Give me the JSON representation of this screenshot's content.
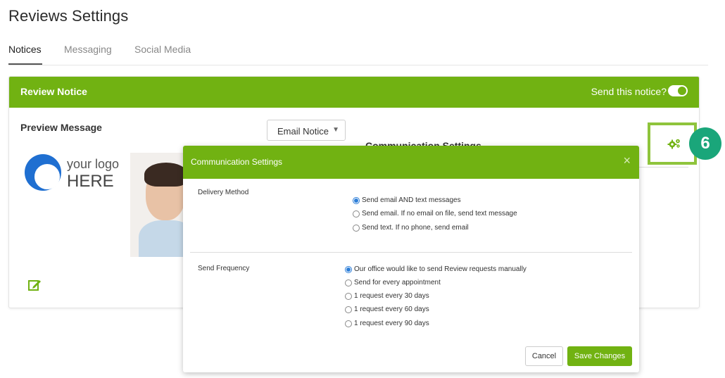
{
  "page": {
    "title": "Reviews Settings"
  },
  "tabs": [
    {
      "label": "Notices",
      "active": true
    },
    {
      "label": "Messaging",
      "active": false
    },
    {
      "label": "Social Media",
      "active": false
    }
  ],
  "notice_card": {
    "title": "Review Notice",
    "send_toggle_label": "Send this notice?",
    "send_toggle_on": true,
    "preview_label": "Preview Message",
    "notice_type_selected": "Email Notice",
    "comm_settings_heading": "Communication Settings",
    "logo_line1": "your logo",
    "logo_line2": "HERE"
  },
  "callout": {
    "step_number": "6"
  },
  "modal": {
    "title": "Communication Settings",
    "close_glyph": "×",
    "delivery_method": {
      "label": "Delivery Method",
      "options": [
        {
          "label": "Send email AND text messages",
          "checked": true
        },
        {
          "label": "Send email. If no email on file, send text message",
          "checked": false
        },
        {
          "label": "Send text. If no phone, send email",
          "checked": false
        }
      ]
    },
    "send_frequency": {
      "label": "Send Frequency",
      "options": [
        {
          "label": "Our office would like to send Review requests manually",
          "checked": true
        },
        {
          "label": "Send for every appointment",
          "checked": false
        },
        {
          "label": "1 request every 30 days",
          "checked": false
        },
        {
          "label": "1 request every 60 days",
          "checked": false
        },
        {
          "label": "1 request every 90 days",
          "checked": false
        }
      ]
    },
    "cancel_label": "Cancel",
    "save_label": "Save Changes"
  },
  "colors": {
    "brand_green": "#71b212",
    "step_badge": "#1aa67a",
    "radio_checked": "#2d7ed8"
  }
}
